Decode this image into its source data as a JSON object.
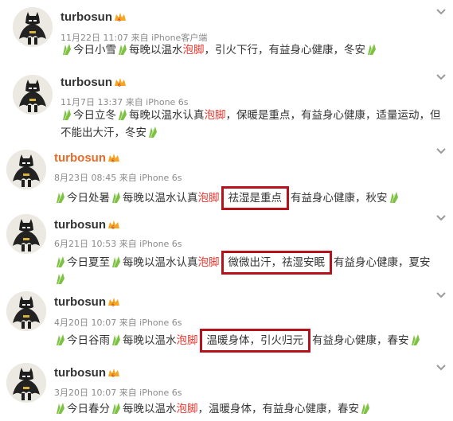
{
  "posts": [
    {
      "username": "turbosun",
      "timestamp": "11月22日 11:07 来自 iPhone客户端",
      "content": {
        "before": "今日小雪",
        "mid": "每晚以温水",
        "highlight": "泡脚",
        "after": "，引火下行，有益身心健康，冬安"
      }
    },
    {
      "username": "turbosun",
      "timestamp": "11月7日 13:37 来自 iPhone 6s",
      "content": {
        "before": "今日立冬",
        "mid": "每晚以温水认真",
        "highlight": "泡脚",
        "after": "，保暖是重点，有益身心健康，适量运动，但不能出大汗，冬安"
      }
    },
    {
      "username": "turbosun",
      "timestamp": "8月23日 08:45 来自 iPhone 6s",
      "content": {
        "before": "今日处暑",
        "mid": "每晚以温水认真",
        "highlight": "泡脚",
        "boxed": "祛湿是重点",
        "after": "有益身心健康，秋安"
      }
    },
    {
      "username": "turbosun",
      "timestamp": "6月21日 10:53 来自 iPhone 6s",
      "content": {
        "before": "今日夏至",
        "mid": "每晚以温水认真",
        "highlight": "泡脚",
        "boxed": "微微出汗，祛湿安眠",
        "after": "有益身心健康，夏安"
      }
    },
    {
      "username": "turbosun",
      "timestamp": "4月20日 10:07 来自 iPhone 6s",
      "content": {
        "before": "今日谷雨",
        "mid": "每晚以温水",
        "highlight": "泡脚",
        "boxed": "温暖身体，引火归元",
        "after": "有益身心健康，春安"
      }
    },
    {
      "username": "turbosun",
      "timestamp": "3月20日 10:07 来自 iPhone 6s",
      "content": {
        "before": "今日春分",
        "mid": "每晚以温水",
        "highlight": "泡脚",
        "after": "，温暖身体，有益身心健康，春安"
      }
    }
  ],
  "colors": {
    "highlight": "#e8362e",
    "box_border": "#b5121b",
    "leaf": "#7dc142",
    "orange_username": "#e86b29"
  },
  "icons": [
    "batman-avatar",
    "vip-badge-icon",
    "chevron-down-icon",
    "leaf-emoji-icon"
  ]
}
